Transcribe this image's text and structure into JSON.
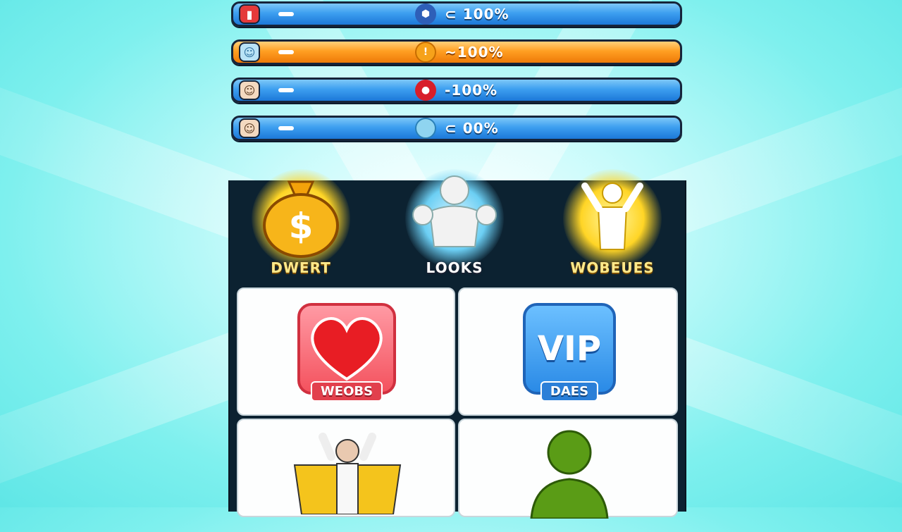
{
  "stat_bars": [
    {
      "icon": "red-card-icon",
      "dash": "—",
      "mid_icon": "blue-shield-icon",
      "value": "100%",
      "prefix": "⊂"
    },
    {
      "icon": "character-face-icon",
      "dash": "—",
      "mid_icon": "orange-coin-icon",
      "value": "100%",
      "prefix": "~"
    },
    {
      "icon": "character-face-icon",
      "dash": "—",
      "mid_icon": "red-gem-icon",
      "value": "100%",
      "prefix": "-"
    },
    {
      "icon": "character-face-icon",
      "dash": "—",
      "mid_icon": "blue-orb-icon",
      "value": "00%",
      "prefix": "⊂"
    }
  ],
  "categories": [
    {
      "icon": "money-bag-icon",
      "label": "DWERT"
    },
    {
      "icon": "muscle-figure-icon",
      "label": "LOOKS"
    },
    {
      "icon": "cheering-figure-icon",
      "label": "WOBEUES"
    }
  ],
  "tiles": [
    {
      "icon": "heart-icon",
      "ribbon": "WEOBS"
    },
    {
      "icon": "vip-badge-icon",
      "badge_text": "VIP",
      "ribbon": "DAES"
    },
    {
      "icon": "robed-figure-icon"
    },
    {
      "icon": "avatar-silhouette-icon"
    }
  ],
  "colors": {
    "blue_bar": "#3d9ff0",
    "orange_bar": "#ff9f22",
    "panel": "#0c2231",
    "gold": "#ffd526"
  }
}
